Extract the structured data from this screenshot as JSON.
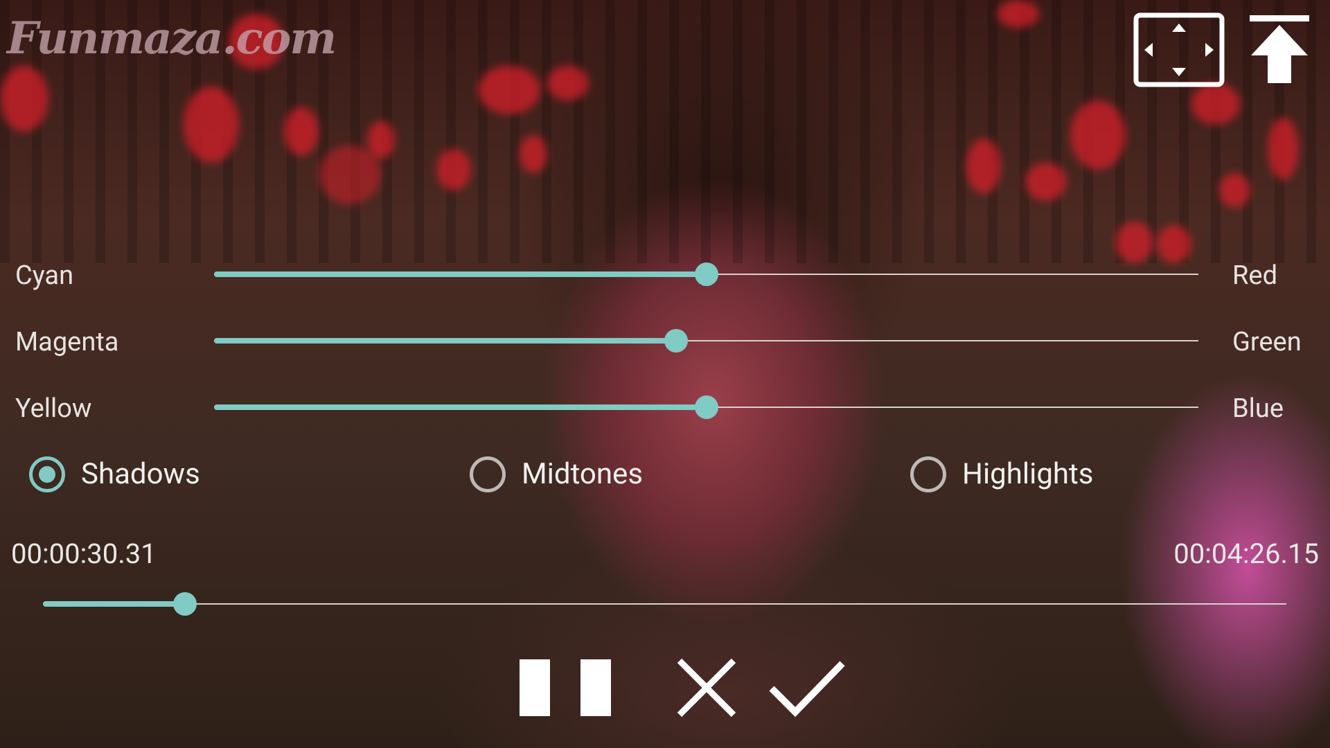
{
  "watermark": "Funmaza.com",
  "top_controls": [
    {
      "icon": "fit-screen-icon"
    },
    {
      "icon": "upload-icon"
    }
  ],
  "color_balance": [
    {
      "left_label": "Cyan",
      "right_label": "Red",
      "value": 0.5
    },
    {
      "left_label": "Magenta",
      "right_label": "Green",
      "value": 0.469
    },
    {
      "left_label": "Yellow",
      "right_label": "Blue",
      "value": 0.5
    }
  ],
  "tone_range": {
    "options": [
      "Shadows",
      "Midtones",
      "Highlights"
    ],
    "selected": "Shadows"
  },
  "playback": {
    "current_time": "00:00:30.31",
    "total_time": "00:04:26.15",
    "progress": 0.114
  },
  "bottom_controls": [
    {
      "icon": "pause-icon"
    },
    {
      "icon": "close-icon"
    },
    {
      "icon": "check-icon"
    }
  ],
  "colors": {
    "accent": "#80cbc4",
    "text": "#ffffff",
    "track": "#d8d2ce"
  }
}
